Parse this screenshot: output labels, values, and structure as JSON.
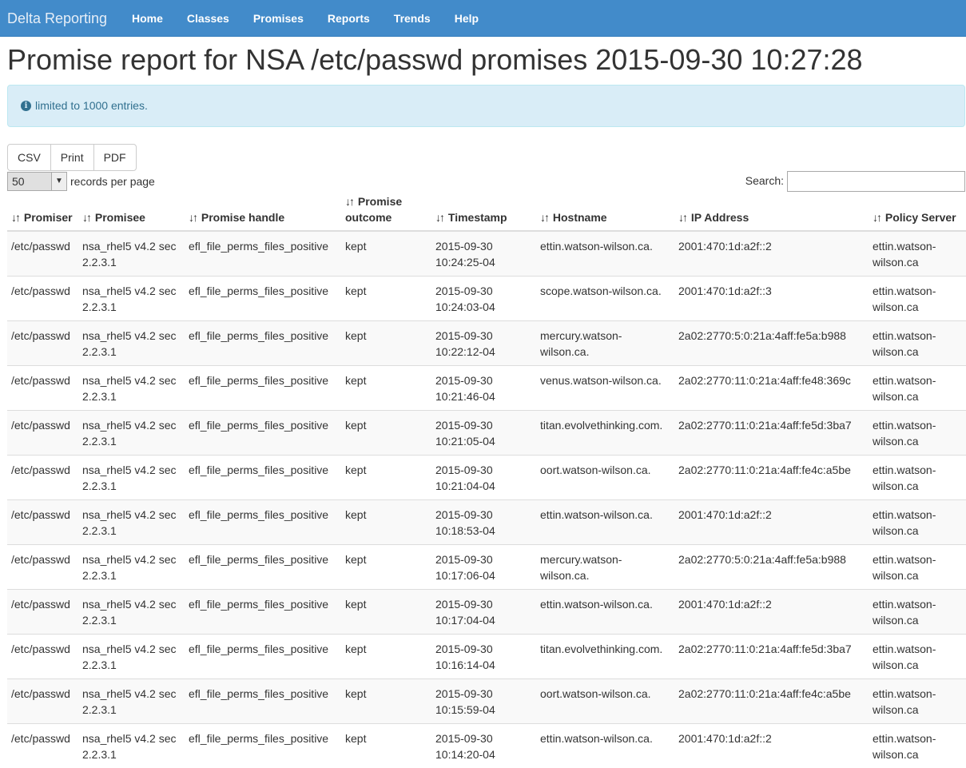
{
  "app": {
    "brand": "Delta Reporting"
  },
  "nav": {
    "items": [
      "Home",
      "Classes",
      "Promises",
      "Reports",
      "Trends",
      "Help"
    ]
  },
  "page": {
    "title": "Promise report for NSA /etc/passwd promises 2015-09-30 10:27:28"
  },
  "alert": {
    "text": "limited to 1000 entries.",
    "icon": "info-circle-icon"
  },
  "export_buttons": [
    "CSV",
    "Print",
    "PDF"
  ],
  "records_per_page": {
    "value": "50",
    "label": "records per page"
  },
  "search": {
    "label": "Search:",
    "value": ""
  },
  "table": {
    "columns": [
      "Promiser",
      "Promisee",
      "Promise handle",
      "Promise outcome",
      "Timestamp",
      "Hostname",
      "IP Address",
      "Policy Server"
    ],
    "rows": [
      [
        "/etc/passwd",
        "nsa_rhel5 v4.2 sec 2.2.3.1",
        "efl_file_perms_files_positive",
        "kept",
        "2015-09-30 10:24:25-04",
        "ettin.watson-wilson.ca.",
        "2001:470:1d:a2f::2",
        "ettin.watson-wilson.ca"
      ],
      [
        "/etc/passwd",
        "nsa_rhel5 v4.2 sec 2.2.3.1",
        "efl_file_perms_files_positive",
        "kept",
        "2015-09-30 10:24:03-04",
        "scope.watson-wilson.ca.",
        "2001:470:1d:a2f::3",
        "ettin.watson-wilson.ca"
      ],
      [
        "/etc/passwd",
        "nsa_rhel5 v4.2 sec 2.2.3.1",
        "efl_file_perms_files_positive",
        "kept",
        "2015-09-30 10:22:12-04",
        "mercury.watson-wilson.ca.",
        "2a02:2770:5:0:21a:4aff:fe5a:b988",
        "ettin.watson-wilson.ca"
      ],
      [
        "/etc/passwd",
        "nsa_rhel5 v4.2 sec 2.2.3.1",
        "efl_file_perms_files_positive",
        "kept",
        "2015-09-30 10:21:46-04",
        "venus.watson-wilson.ca.",
        "2a02:2770:11:0:21a:4aff:fe48:369c",
        "ettin.watson-wilson.ca"
      ],
      [
        "/etc/passwd",
        "nsa_rhel5 v4.2 sec 2.2.3.1",
        "efl_file_perms_files_positive",
        "kept",
        "2015-09-30 10:21:05-04",
        "titan.evolvethinking.com.",
        "2a02:2770:11:0:21a:4aff:fe5d:3ba7",
        "ettin.watson-wilson.ca"
      ],
      [
        "/etc/passwd",
        "nsa_rhel5 v4.2 sec 2.2.3.1",
        "efl_file_perms_files_positive",
        "kept",
        "2015-09-30 10:21:04-04",
        "oort.watson-wilson.ca.",
        "2a02:2770:11:0:21a:4aff:fe4c:a5be",
        "ettin.watson-wilson.ca"
      ],
      [
        "/etc/passwd",
        "nsa_rhel5 v4.2 sec 2.2.3.1",
        "efl_file_perms_files_positive",
        "kept",
        "2015-09-30 10:18:53-04",
        "ettin.watson-wilson.ca.",
        "2001:470:1d:a2f::2",
        "ettin.watson-wilson.ca"
      ],
      [
        "/etc/passwd",
        "nsa_rhel5 v4.2 sec 2.2.3.1",
        "efl_file_perms_files_positive",
        "kept",
        "2015-09-30 10:17:06-04",
        "mercury.watson-wilson.ca.",
        "2a02:2770:5:0:21a:4aff:fe5a:b988",
        "ettin.watson-wilson.ca"
      ],
      [
        "/etc/passwd",
        "nsa_rhel5 v4.2 sec 2.2.3.1",
        "efl_file_perms_files_positive",
        "kept",
        "2015-09-30 10:17:04-04",
        "ettin.watson-wilson.ca.",
        "2001:470:1d:a2f::2",
        "ettin.watson-wilson.ca"
      ],
      [
        "/etc/passwd",
        "nsa_rhel5 v4.2 sec 2.2.3.1",
        "efl_file_perms_files_positive",
        "kept",
        "2015-09-30 10:16:14-04",
        "titan.evolvethinking.com.",
        "2a02:2770:11:0:21a:4aff:fe5d:3ba7",
        "ettin.watson-wilson.ca"
      ],
      [
        "/etc/passwd",
        "nsa_rhel5 v4.2 sec 2.2.3.1",
        "efl_file_perms_files_positive",
        "kept",
        "2015-09-30 10:15:59-04",
        "oort.watson-wilson.ca.",
        "2a02:2770:11:0:21a:4aff:fe4c:a5be",
        "ettin.watson-wilson.ca"
      ],
      [
        "/etc/passwd",
        "nsa_rhel5 v4.2 sec 2.2.3.1",
        "efl_file_perms_files_positive",
        "kept",
        "2015-09-30 10:14:20-04",
        "ettin.watson-wilson.ca.",
        "2001:470:1d:a2f::2",
        "ettin.watson-wilson.ca"
      ]
    ]
  },
  "colors": {
    "navbar": "#428bca",
    "alert_bg": "#d9edf7",
    "alert_text": "#31708f"
  }
}
